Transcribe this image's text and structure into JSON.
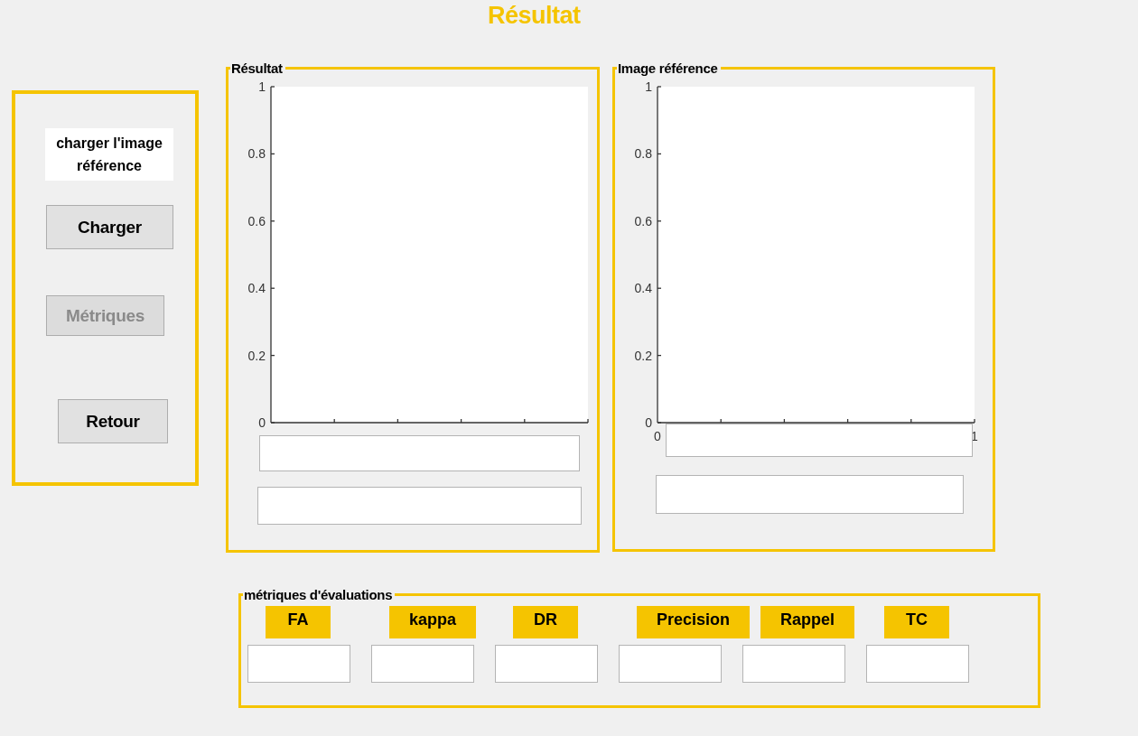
{
  "title": "Résultat",
  "side_panel": {
    "caption": "charger l'image référence",
    "buttons": [
      {
        "label": "Charger",
        "disabled": false
      },
      {
        "label": "Métriques",
        "disabled": true
      },
      {
        "label": "Retour",
        "disabled": false
      }
    ]
  },
  "axes_panels": [
    {
      "title": "Résultat",
      "chart_data": {
        "type": "line",
        "categories": [
          null,
          null,
          null,
          null,
          null,
          null
        ],
        "ylim": [
          0,
          1
        ],
        "yticks": [
          0,
          0.2,
          0.4,
          0.6,
          0.8,
          1
        ]
      }
    },
    {
      "title": "Image référence",
      "chart_data": {
        "type": "line",
        "xlim": [
          0,
          1
        ],
        "ylim": [
          0,
          1
        ],
        "yticks": [
          0,
          0.2,
          0.4,
          0.6,
          0.8,
          1
        ],
        "xticks": [
          0,
          1
        ]
      }
    }
  ],
  "metrics_panel": {
    "title": "métriques d'évaluations",
    "items": [
      {
        "label": "FA"
      },
      {
        "label": "kappa"
      },
      {
        "label": "DR"
      },
      {
        "label": "Precision"
      },
      {
        "label": "Rappel"
      },
      {
        "label": "TC"
      }
    ]
  }
}
